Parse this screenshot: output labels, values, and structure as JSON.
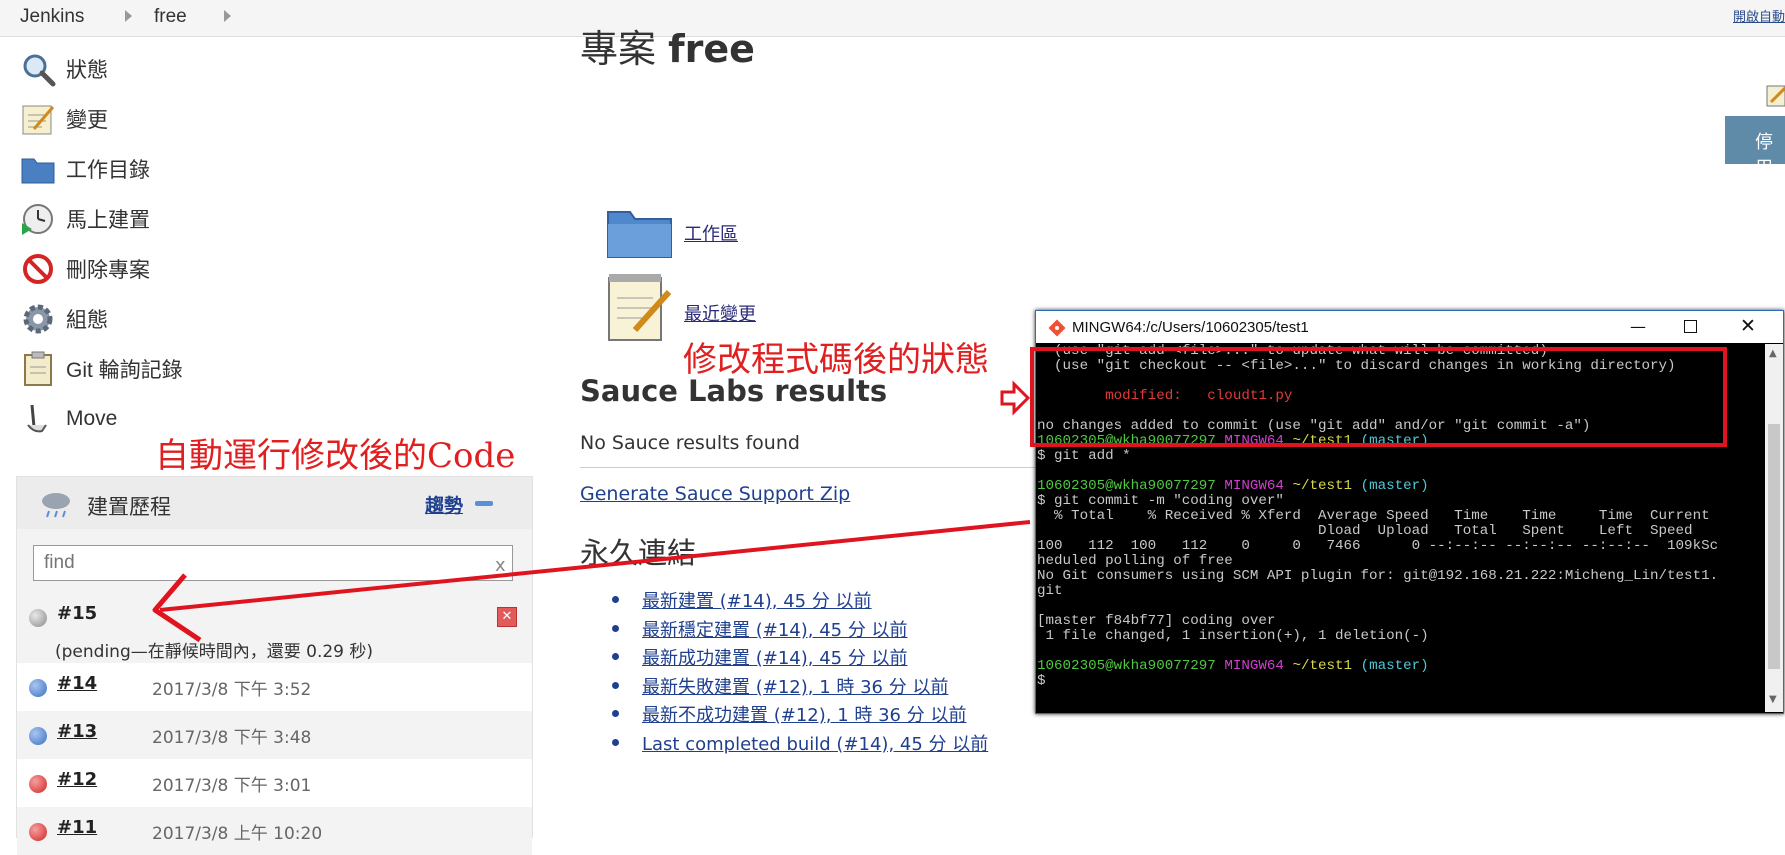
{
  "breadcrumb": {
    "root": "Jenkins",
    "project": "free",
    "top_right": "開啟自動"
  },
  "sidebar": {
    "items": [
      {
        "label": "狀態",
        "icon": "search-icon"
      },
      {
        "label": "變更",
        "icon": "notepad-icon"
      },
      {
        "label": "工作目錄",
        "icon": "folder-icon"
      },
      {
        "label": "馬上建置",
        "icon": "clock-icon"
      },
      {
        "label": "刪除專案",
        "icon": "no-entry-icon"
      },
      {
        "label": "組態",
        "icon": "gear-icon"
      },
      {
        "label": "Git 輪詢記錄",
        "icon": "clipboard-icon"
      },
      {
        "label": "Move",
        "icon": "move-icon"
      }
    ]
  },
  "build_history": {
    "title": "建置歷程",
    "trend_label": "趨勢",
    "search_placeholder": "find",
    "search_clear": "x",
    "pending": {
      "number": "#15",
      "note": "(pending—在靜候時間內，還要 0.29 秒)"
    },
    "builds": [
      {
        "number": "#14",
        "date": "2017/3/8 下午 3:52",
        "status": "blue"
      },
      {
        "number": "#13",
        "date": "2017/3/8 下午 3:48",
        "status": "blue"
      },
      {
        "number": "#12",
        "date": "2017/3/8 下午 3:01",
        "status": "red"
      },
      {
        "number": "#11",
        "date": "2017/3/8 上午 10:20",
        "status": "red"
      }
    ]
  },
  "main": {
    "project_title_prefix": "專案",
    "project_title_name": "free",
    "workspace_link": "工作區",
    "recent_changes_link": "最近變更",
    "sauce_heading": "Sauce Labs results",
    "sauce_none": "No Sauce results found",
    "sauce_zip": "Generate Sauce Support Zip",
    "permalinks_heading": "永久連結",
    "permalinks": [
      "最新建置 (#14), 45 分 以前",
      "最新穩定建置 (#14), 45 分 以前",
      "最新成功建置 (#14), 45 分 以前",
      "最新失敗建置 (#12), 1 時 36 分 以前",
      "最新不成功建置 (#12), 1 時 36 分 以前",
      "Last completed build (#14), 45 分 以前"
    ],
    "disable_button": "停用"
  },
  "terminal": {
    "title": "MINGW64:/c/Users/10602305/test1",
    "lines": [
      {
        "segments": [
          {
            "t": "  (use \"git add <file>...\" to update what will be committed)",
            "c": ""
          }
        ]
      },
      {
        "segments": [
          {
            "t": "  (use \"git checkout -- <file>...\" to discard changes in working directory)",
            "c": ""
          }
        ]
      },
      {
        "segments": [
          {
            "t": "",
            "c": ""
          }
        ]
      },
      {
        "segments": [
          {
            "t": "        modified:   cloudt1.py",
            "c": "r"
          }
        ]
      },
      {
        "segments": [
          {
            "t": "",
            "c": ""
          }
        ]
      },
      {
        "segments": [
          {
            "t": "no changes added to commit (use \"git add\" and/or \"git commit -a\")",
            "c": ""
          }
        ]
      },
      {
        "segments": [
          {
            "t": "10602305@wkha90077297 ",
            "c": "g"
          },
          {
            "t": "MINGW64 ",
            "c": "m"
          },
          {
            "t": "~/test1 ",
            "c": "y"
          },
          {
            "t": "(master)",
            "c": "c"
          }
        ]
      },
      {
        "segments": [
          {
            "t": "$ git add *",
            "c": ""
          }
        ]
      },
      {
        "segments": [
          {
            "t": "",
            "c": ""
          }
        ]
      },
      {
        "segments": [
          {
            "t": "10602305@wkha90077297 ",
            "c": "g"
          },
          {
            "t": "MINGW64 ",
            "c": "m"
          },
          {
            "t": "~/test1 ",
            "c": "y"
          },
          {
            "t": "(master)",
            "c": "c"
          }
        ]
      },
      {
        "segments": [
          {
            "t": "$ git commit -m \"coding over\"",
            "c": ""
          }
        ]
      },
      {
        "segments": [
          {
            "t": "  % Total    % Received % Xferd  Average Speed   Time    Time     Time  Current",
            "c": ""
          }
        ]
      },
      {
        "segments": [
          {
            "t": "                                 Dload  Upload   Total   Spent    Left  Speed",
            "c": ""
          }
        ]
      },
      {
        "segments": [
          {
            "t": "100   112  100   112    0     0   7466      0 --:--:-- --:--:-- --:--:--  109kSc",
            "c": ""
          }
        ]
      },
      {
        "segments": [
          {
            "t": "heduled polling of free",
            "c": ""
          }
        ]
      },
      {
        "segments": [
          {
            "t": "No Git consumers using SCM API plugin for: git@192.168.21.222:Micheng_Lin/test1.",
            "c": ""
          }
        ]
      },
      {
        "segments": [
          {
            "t": "git",
            "c": ""
          }
        ]
      },
      {
        "segments": [
          {
            "t": "",
            "c": ""
          }
        ]
      },
      {
        "segments": [
          {
            "t": "[master f84bf77] coding over",
            "c": ""
          }
        ]
      },
      {
        "segments": [
          {
            "t": " 1 file changed, 1 insertion(+), 1 deletion(-)",
            "c": ""
          }
        ]
      },
      {
        "segments": [
          {
            "t": "",
            "c": ""
          }
        ]
      },
      {
        "segments": [
          {
            "t": "10602305@wkha90077297 ",
            "c": "g"
          },
          {
            "t": "MINGW64 ",
            "c": "m"
          },
          {
            "t": "~/test1 ",
            "c": "y"
          },
          {
            "t": "(master)",
            "c": "c"
          }
        ]
      },
      {
        "segments": [
          {
            "t": "$",
            "c": ""
          }
        ]
      }
    ]
  },
  "annotations": {
    "status_after_edit": "修改程式碼後的狀態",
    "auto_run": "自動運行修改後的Code"
  },
  "colors": {
    "annotation": "#e02020",
    "build_blue": "#3b6fc4",
    "build_red": "#d42424",
    "build_grey": "#a8a8a8"
  }
}
